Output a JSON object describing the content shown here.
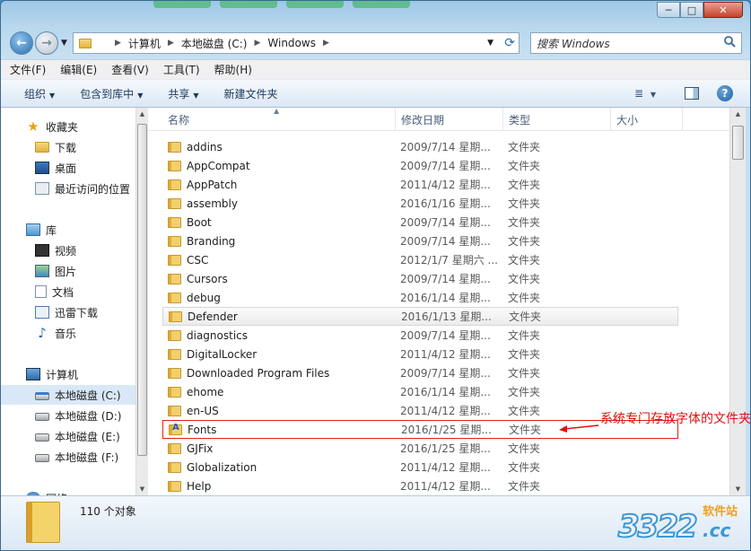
{
  "window": {
    "caption": {
      "minimize": "─",
      "maximize": "□",
      "close": "✕"
    }
  },
  "address": {
    "crumbs": [
      "计算机",
      "本地磁盘 (C:)",
      "Windows"
    ],
    "search_placeholder": "搜索 Windows"
  },
  "menu": [
    "文件(F)",
    "编辑(E)",
    "查看(V)",
    "工具(T)",
    "帮助(H)"
  ],
  "toolbar": {
    "organize": "组织",
    "include_library": "包含到库中",
    "share": "共享",
    "new_folder": "新建文件夹",
    "view_icon": "≣",
    "help": "?"
  },
  "nav": {
    "favorites": "收藏夹",
    "downloads": "下载",
    "desktop": "桌面",
    "recent": "最近访问的位置",
    "libraries": "库",
    "videos": "视频",
    "pictures": "图片",
    "documents": "文档",
    "thunder": "迅雷下载",
    "music": "音乐",
    "computer": "计算机",
    "drive_c": "本地磁盘 (C:)",
    "drive_d": "本地磁盘 (D:)",
    "drive_e": "本地磁盘 (E:)",
    "drive_f": "本地磁盘 (F:)",
    "network": "网络"
  },
  "columns": {
    "name": "名称",
    "date": "修改日期",
    "type": "类型",
    "size": "大小"
  },
  "files": [
    {
      "name": "addins",
      "date": "2009/7/14 星期...",
      "type": "文件夹"
    },
    {
      "name": "AppCompat",
      "date": "2009/7/14 星期...",
      "type": "文件夹"
    },
    {
      "name": "AppPatch",
      "date": "2011/4/12 星期...",
      "type": "文件夹"
    },
    {
      "name": "assembly",
      "date": "2016/1/16 星期...",
      "type": "文件夹"
    },
    {
      "name": "Boot",
      "date": "2009/7/14 星期...",
      "type": "文件夹"
    },
    {
      "name": "Branding",
      "date": "2009/7/14 星期...",
      "type": "文件夹"
    },
    {
      "name": "CSC",
      "date": "2012/1/7 星期六 ...",
      "type": "文件夹"
    },
    {
      "name": "Cursors",
      "date": "2009/7/14 星期...",
      "type": "文件夹"
    },
    {
      "name": "debug",
      "date": "2016/1/14 星期...",
      "type": "文件夹"
    },
    {
      "name": "Defender",
      "date": "2016/1/13 星期...",
      "type": "文件夹"
    },
    {
      "name": "diagnostics",
      "date": "2009/7/14 星期...",
      "type": "文件夹"
    },
    {
      "name": "DigitalLocker",
      "date": "2011/4/12 星期...",
      "type": "文件夹"
    },
    {
      "name": "Downloaded Program Files",
      "date": "2009/7/14 星期...",
      "type": "文件夹"
    },
    {
      "name": "ehome",
      "date": "2016/1/14 星期...",
      "type": "文件夹"
    },
    {
      "name": "en-US",
      "date": "2011/4/12 星期...",
      "type": "文件夹"
    },
    {
      "name": "Fonts",
      "date": "2016/1/25 星期...",
      "type": "文件夹"
    },
    {
      "name": "GJFix",
      "date": "2016/1/25 星期...",
      "type": "文件夹"
    },
    {
      "name": "Globalization",
      "date": "2011/4/12 星期...",
      "type": "文件夹"
    },
    {
      "name": "Help",
      "date": "2011/4/12 星期...",
      "type": "文件夹"
    }
  ],
  "status": {
    "count": "110 个对象"
  },
  "annotation": {
    "text": "系统专门存放字体的文件夹"
  },
  "watermark": {
    "number": "3322",
    "site": "软件站",
    "cc": ".cc"
  },
  "colors": {
    "annotation": "#e01010",
    "hover_row": "#ececec",
    "selected_nav": "#d9e8f7"
  }
}
